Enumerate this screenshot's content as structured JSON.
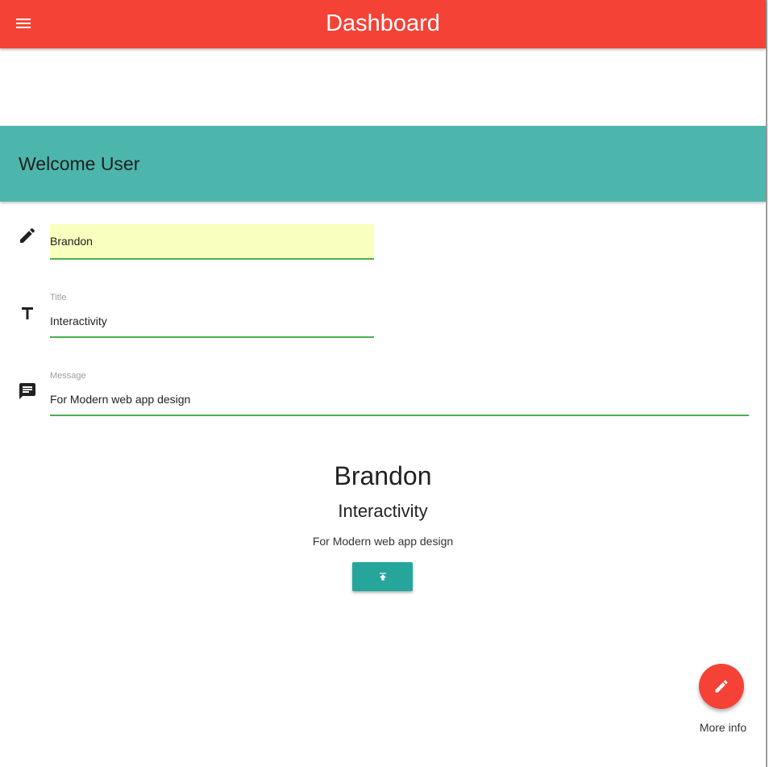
{
  "appbar": {
    "title": "Dashboard",
    "menu_icon": "menu-icon",
    "color": "#f44336"
  },
  "banner": {
    "text": "Welcome User",
    "color": "#4db6ac"
  },
  "form": {
    "name": {
      "value": "Brandon",
      "icon": "pencil-icon"
    },
    "title": {
      "label": "Title",
      "value": "Interactivity",
      "icon": "text-format-icon"
    },
    "message": {
      "label": "Message",
      "value": "For Modern web app design",
      "icon": "message-icon"
    },
    "underline_color": "#4caf50"
  },
  "preview": {
    "name": "Brandon",
    "title": "Interactivity",
    "message": "For Modern web app design",
    "button_icon": "publish-icon",
    "button_color": "#26a69a"
  },
  "fab": {
    "icon": "pencil-icon",
    "label": "More info",
    "color": "#f44336"
  }
}
